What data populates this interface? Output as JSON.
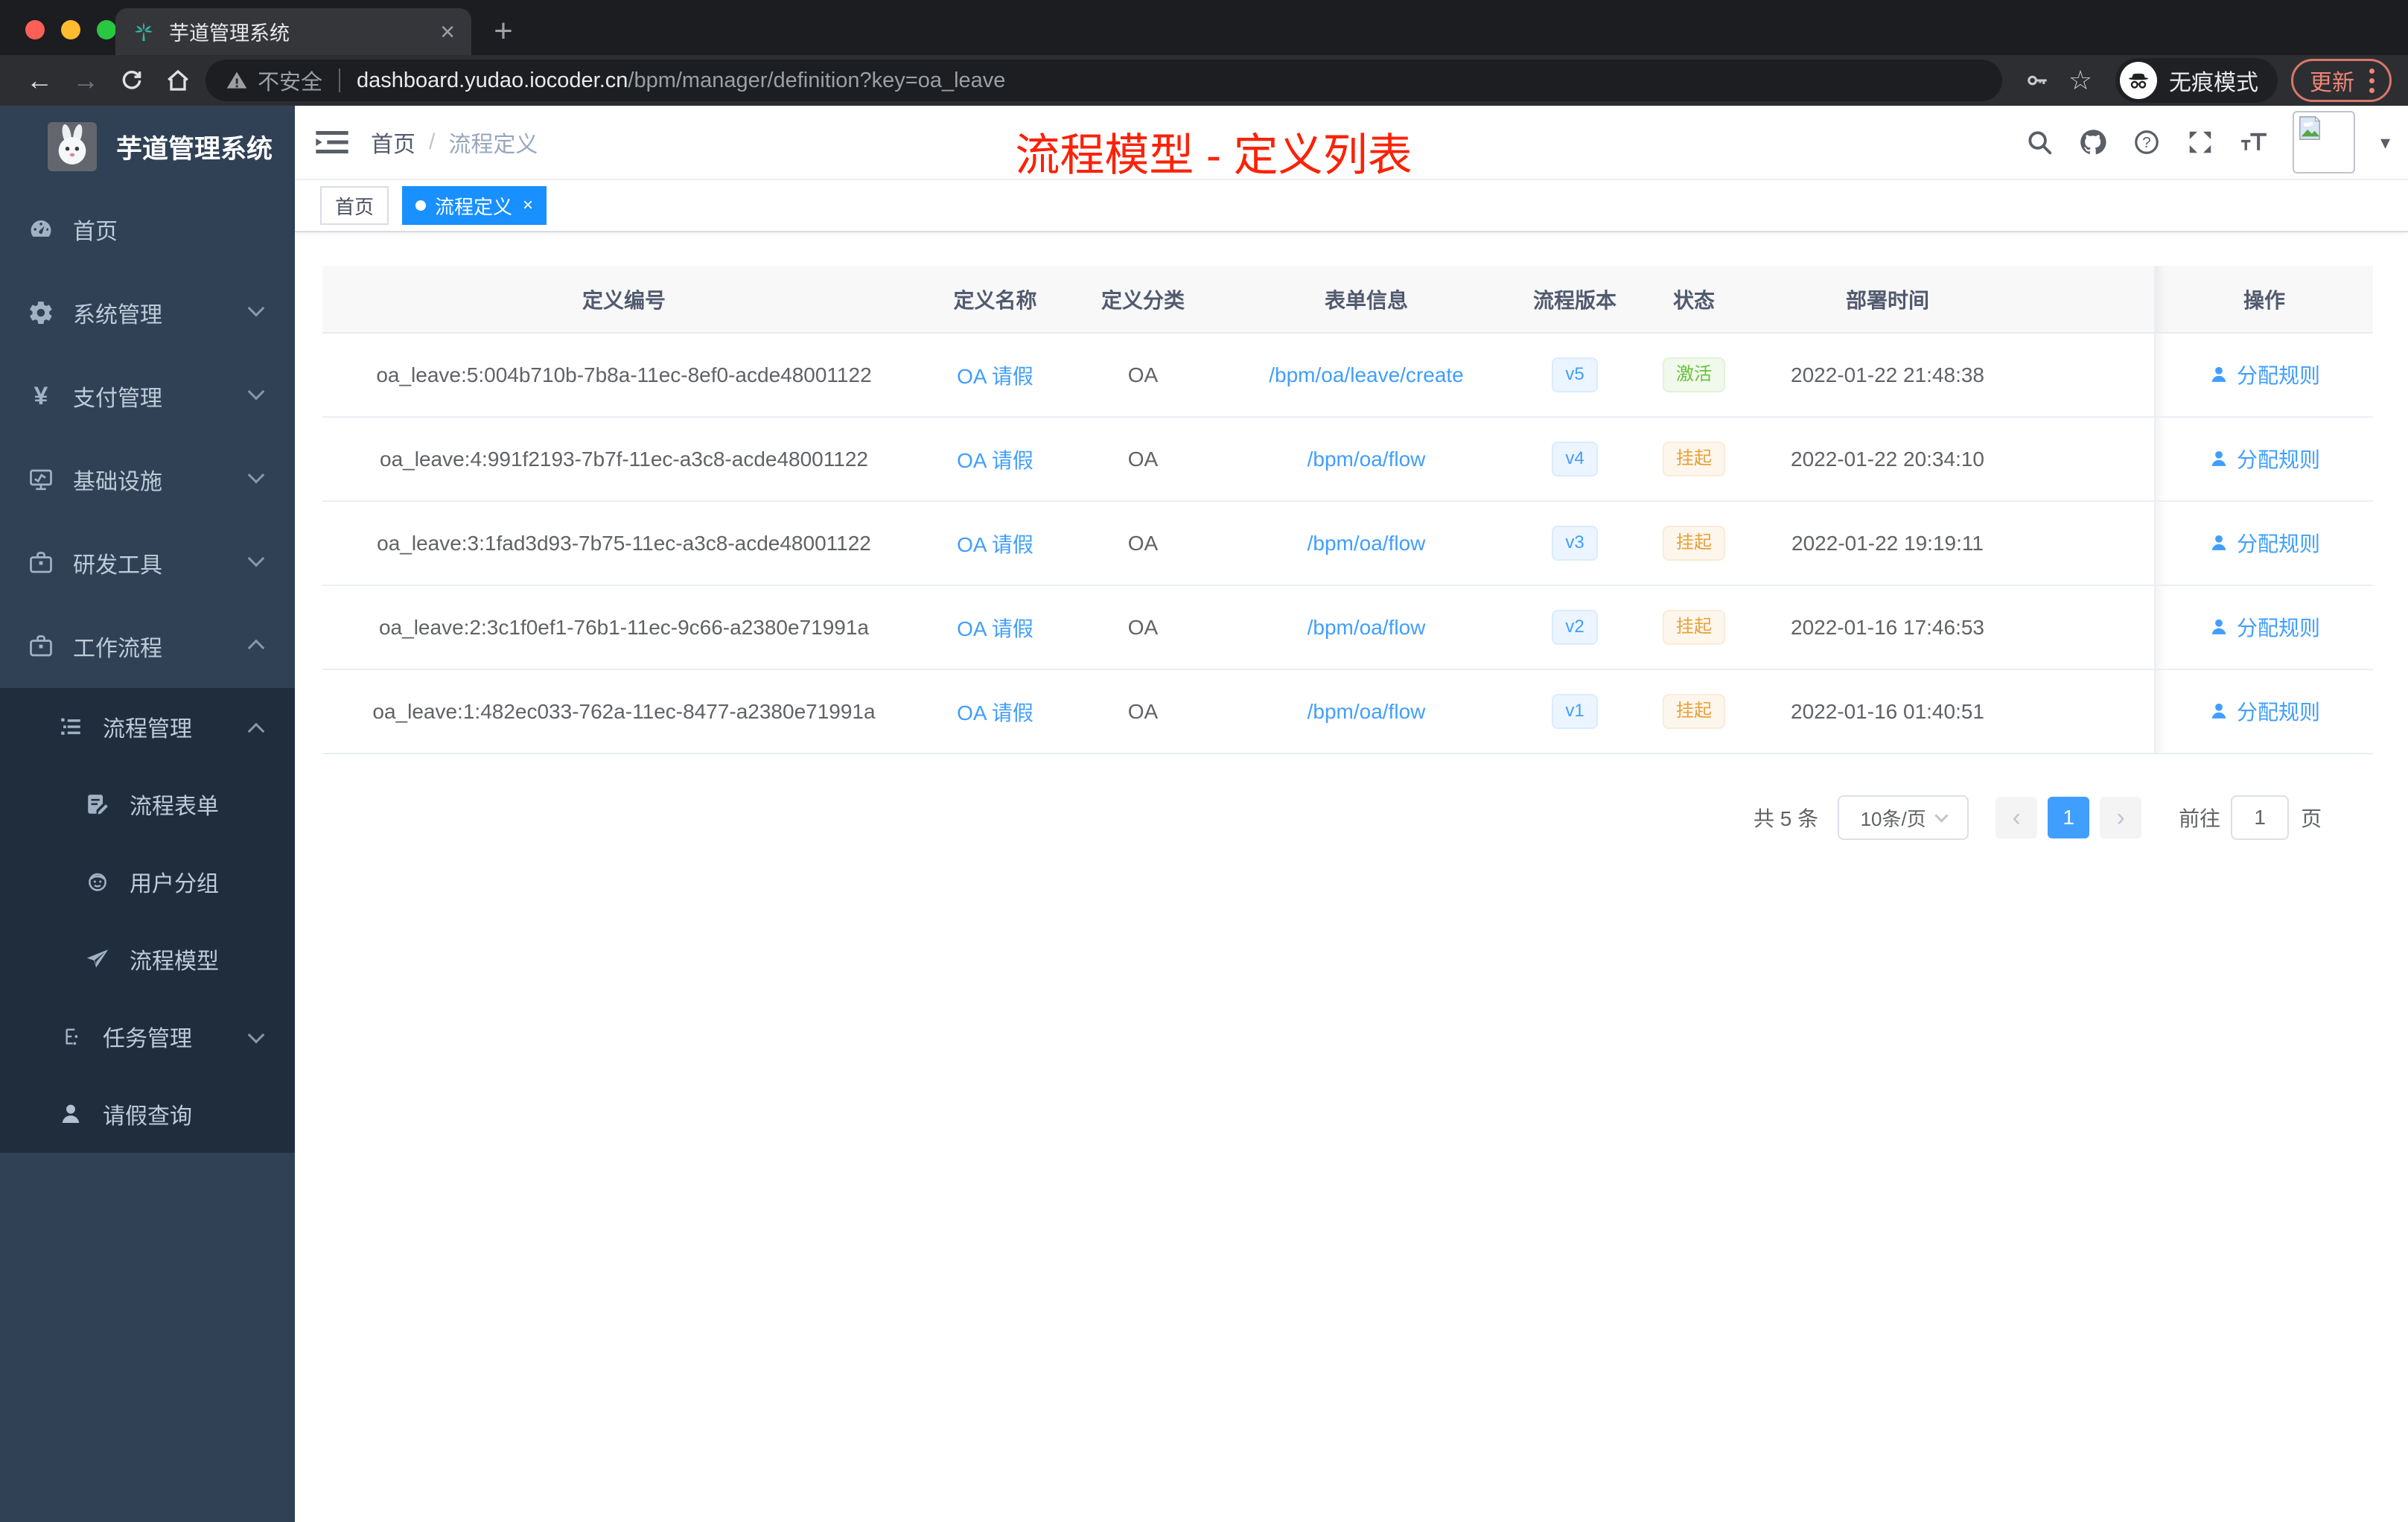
{
  "browser": {
    "tab_title": "芋道管理系统",
    "new_tab_label": "+",
    "close_tab_label": "×",
    "security_label": "不安全",
    "url_host": "dashboard.yudao.iocoder.cn",
    "url_path": "/bpm/manager/definition?key=oa_leave",
    "incognito_label": "无痕模式",
    "update_label": "更新"
  },
  "sidebar": {
    "logo_title": "芋道管理系统",
    "items": [
      {
        "label": "首页"
      },
      {
        "label": "系统管理"
      },
      {
        "label": "支付管理"
      },
      {
        "label": "基础设施"
      },
      {
        "label": "研发工具"
      },
      {
        "label": "工作流程"
      },
      {
        "label": "流程管理"
      },
      {
        "label": "流程表单"
      },
      {
        "label": "用户分组"
      },
      {
        "label": "流程模型"
      },
      {
        "label": "任务管理"
      },
      {
        "label": "请假查询"
      }
    ]
  },
  "navbar": {
    "breadcrumb": {
      "home": "首页",
      "separator": "/",
      "current": "流程定义"
    },
    "annotation": "流程模型 - 定义列表",
    "avatar_caret": "▾"
  },
  "tags": {
    "home": "首页",
    "active": "流程定义",
    "active_close": "×"
  },
  "table": {
    "columns": [
      "定义编号",
      "定义名称",
      "定义分类",
      "表单信息",
      "流程版本",
      "状态",
      "部署时间",
      "操作"
    ],
    "rows": [
      {
        "id": "oa_leave:5:004b710b-7b8a-11ec-8ef0-acde48001122",
        "name": "OA 请假",
        "category": "OA",
        "form": "/bpm/oa/leave/create",
        "version": "v5",
        "status": "激活",
        "status_type": "success",
        "time": "2022-01-22 21:48:38",
        "action": "分配规则"
      },
      {
        "id": "oa_leave:4:991f2193-7b7f-11ec-a3c8-acde48001122",
        "name": "OA 请假",
        "category": "OA",
        "form": "/bpm/oa/flow",
        "version": "v4",
        "status": "挂起",
        "status_type": "warning",
        "time": "2022-01-22 20:34:10",
        "action": "分配规则"
      },
      {
        "id": "oa_leave:3:1fad3d93-7b75-11ec-a3c8-acde48001122",
        "name": "OA 请假",
        "category": "OA",
        "form": "/bpm/oa/flow",
        "version": "v3",
        "status": "挂起",
        "status_type": "warning",
        "time": "2022-01-22 19:19:11",
        "action": "分配规则"
      },
      {
        "id": "oa_leave:2:3c1f0ef1-76b1-11ec-9c66-a2380e71991a",
        "name": "OA 请假",
        "category": "OA",
        "form": "/bpm/oa/flow",
        "version": "v2",
        "status": "挂起",
        "status_type": "warning",
        "time": "2022-01-16 17:46:53",
        "action": "分配规则"
      },
      {
        "id": "oa_leave:1:482ec033-762a-11ec-8477-a2380e71991a",
        "name": "OA 请假",
        "category": "OA",
        "form": "/bpm/oa/flow",
        "version": "v1",
        "status": "挂起",
        "status_type": "warning",
        "time": "2022-01-16 01:40:51",
        "action": "分配规则"
      }
    ]
  },
  "pagination": {
    "total_label": "共 5 条",
    "page_size_label": "10条/页",
    "prev_label": "‹",
    "current_page": "1",
    "next_label": "›",
    "goto_label": "前往",
    "goto_value": "1",
    "unit_label": "页"
  },
  "colors": {
    "accent_blue": "#1890ff",
    "link_blue": "#409eff",
    "success_green": "#67c23a",
    "warning_orange": "#e6a23c",
    "sidebar_bg": "#304156",
    "submenu_bg": "#1f2d3d",
    "annotation_red": "#fb2208"
  }
}
